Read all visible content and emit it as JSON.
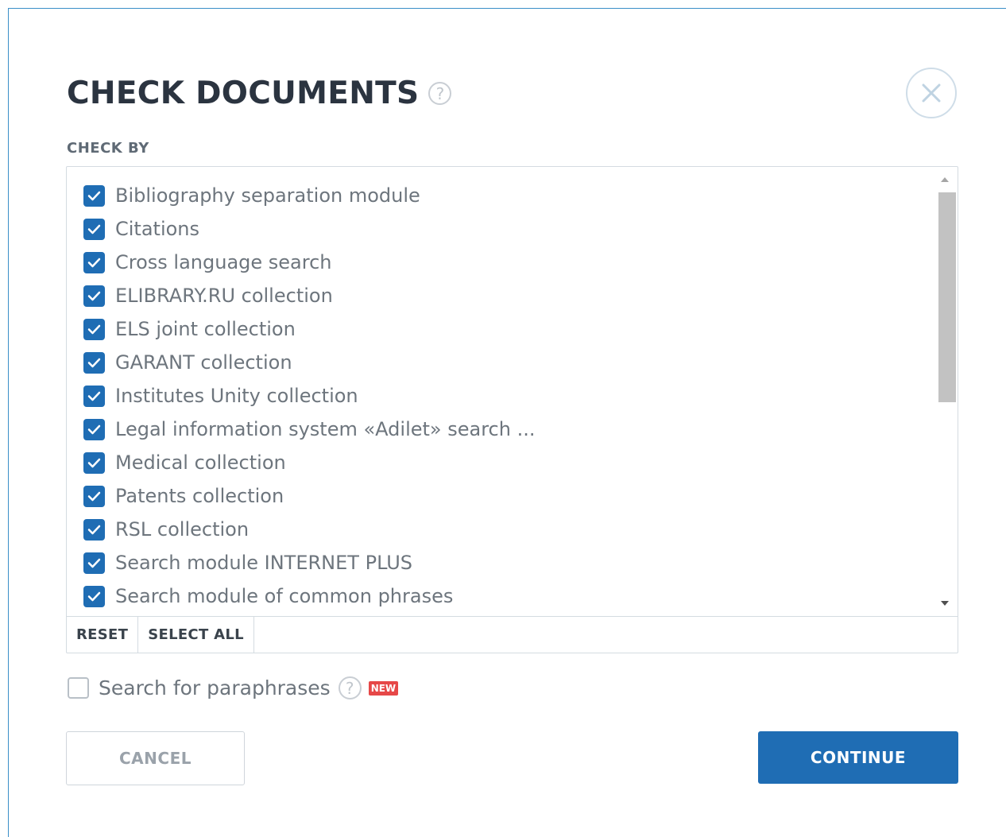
{
  "dialog": {
    "title": "CHECK DOCUMENTS",
    "help_glyph": "?",
    "close_icon": "close-icon"
  },
  "check_by": {
    "label": "CHECK BY",
    "items": [
      {
        "label": "Bibliography separation module",
        "checked": true
      },
      {
        "label": "Citations",
        "checked": true
      },
      {
        "label": "Cross language search",
        "checked": true
      },
      {
        "label": "ELIBRARY.RU collection",
        "checked": true
      },
      {
        "label": "ELS joint collection",
        "checked": true
      },
      {
        "label": "GARANT collection",
        "checked": true
      },
      {
        "label": "Institutes Unity collection",
        "checked": true
      },
      {
        "label": "Legal information system «Adilet» search ...",
        "checked": true
      },
      {
        "label": "Medical collection",
        "checked": true
      },
      {
        "label": "Patents collection",
        "checked": true
      },
      {
        "label": "RSL collection",
        "checked": true
      },
      {
        "label": "Search module INTERNET PLUS",
        "checked": true
      },
      {
        "label": "Search module of common phrases",
        "checked": true
      }
    ],
    "reset_label": "RESET",
    "select_all_label": "SELECT ALL"
  },
  "paraphrase": {
    "label": "Search for paraphrases",
    "checked": false,
    "help_glyph": "?",
    "badge": "NEW"
  },
  "actions": {
    "cancel_label": "CANCEL",
    "continue_label": "CONTINUE"
  },
  "colors": {
    "accent": "#1f6db4",
    "badge": "#e64848",
    "border": "#3a8fc8"
  }
}
